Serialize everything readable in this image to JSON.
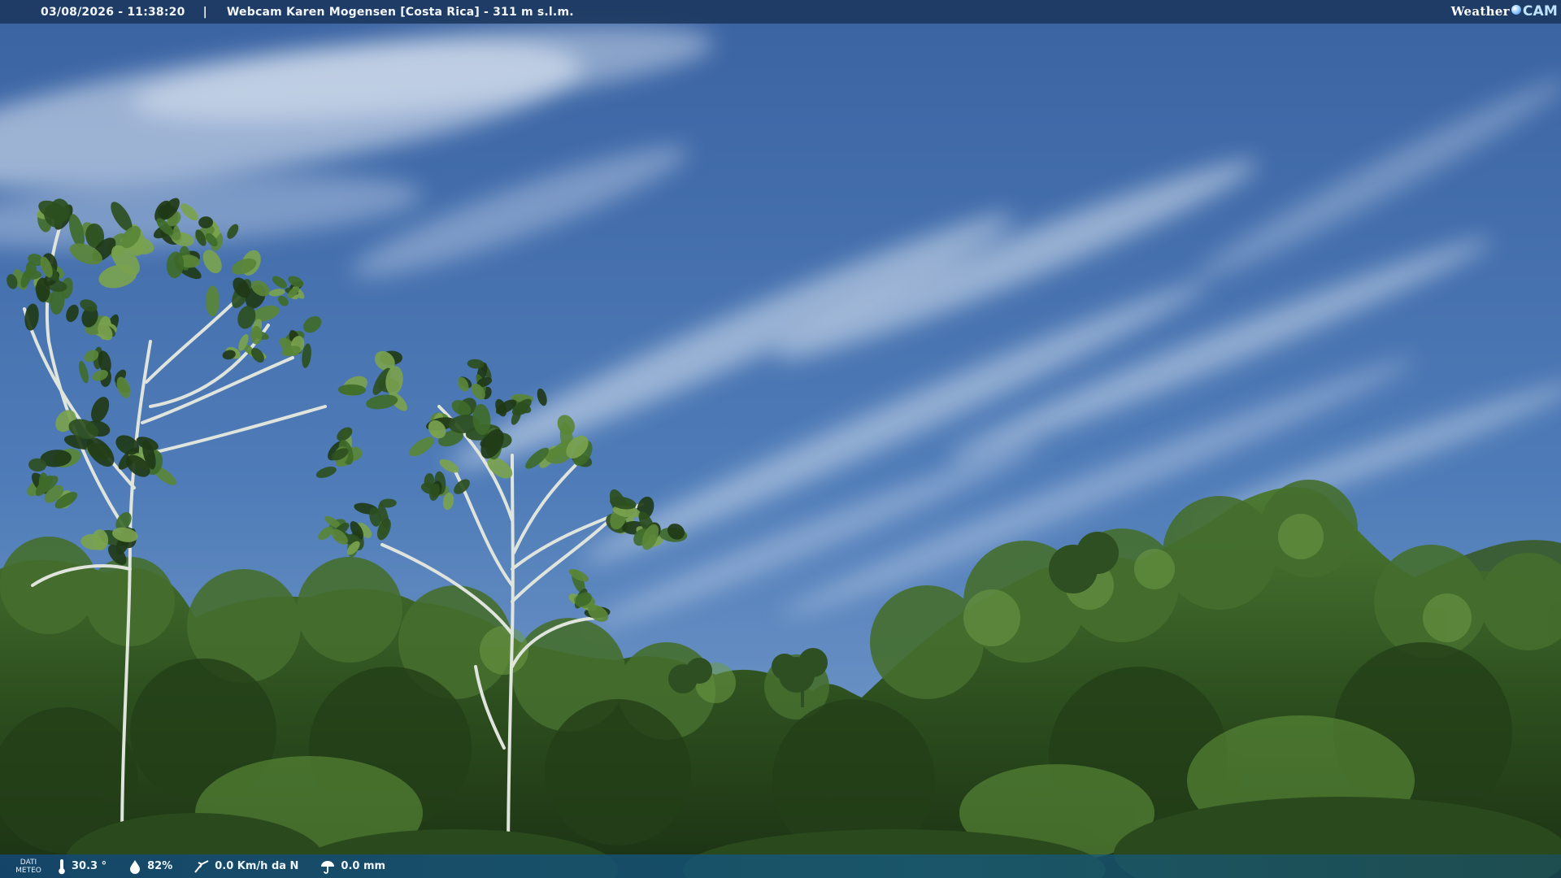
{
  "header": {
    "datetime": "03/08/2026 - 11:38:20",
    "separator": "|",
    "webcam_title": "Webcam Karen Mogensen [Costa Rica] - 311 m s.l.m.",
    "brand": {
      "weather": "Weather",
      "cam": "CAM",
      "icon": "globe-icon"
    }
  },
  "weather_bar": {
    "label_line1": "DATI",
    "label_line2": "METEO",
    "temperature": "30.3 °",
    "humidity": "82%",
    "wind": "0.0 Km/h da N",
    "rain": "0.0 mm",
    "icons": [
      "thermometer-icon",
      "humidity-drop-icon",
      "wind-icon",
      "rain-umbrella-icon"
    ]
  },
  "colors": {
    "sky_top": "#3c67a6",
    "sky_bottom": "#6f98c9",
    "foliage_dark": "#1f3a17",
    "foliage_mid": "#3f6b2a",
    "foliage_light": "#6e9a45",
    "bar": "#1a375c"
  }
}
